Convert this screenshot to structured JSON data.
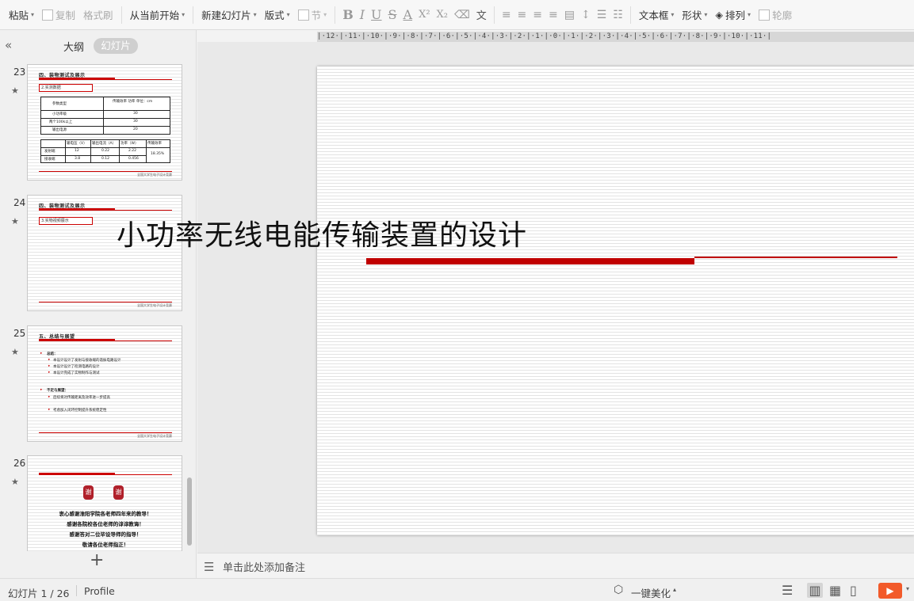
{
  "toolbar": {
    "paste": "粘贴",
    "copy": "复制",
    "format_painter": "格式刷",
    "from_current": "从当前开始",
    "new_slide": "新建幻灯片",
    "layout": "版式",
    "section": "节",
    "text_box": "文本框",
    "shape": "形状",
    "arrange": "排列",
    "outline": "轮廓"
  },
  "left_panel": {
    "tab_outline": "大纲",
    "tab_slides": "幻灯片",
    "thumbnails": [
      {
        "number": "23",
        "title": "四、装物测试及展示",
        "box_label": "2.实测数据",
        "table1": [
          [
            "参数类型",
            "传输效率 功率 单位：cm"
          ],
          [
            "小功率级",
            "30"
          ],
          [
            "两个100k以上",
            "30"
          ],
          [
            "输出电源",
            "20"
          ]
        ],
        "table2": [
          [
            "输电压（V）",
            "输出电流（A）",
            "功率（W）",
            "传输效率"
          ],
          [
            "发射端",
            "12",
            "0.22",
            "2.22",
            "18.35%"
          ],
          [
            "接收端",
            "3.8",
            "0.12",
            "0.456"
          ]
        ],
        "footer": "全国大学生电子设计竞赛"
      },
      {
        "number": "24",
        "title": "四、装物测试及展示",
        "box_label": "3.实物视频展示",
        "footer": "全国大学生电子设计竞赛"
      },
      {
        "number": "25",
        "title": "五、总结与展望",
        "summary_heading": "总结：",
        "summary_items": [
          "本设计设计了发射与接收端的谐振电路设计",
          "本设计设计了检测电路的设计",
          "本设计完成了实物制作与测试"
        ],
        "outlook_heading": "不足与展望：",
        "outlook_items": [
          "后续将对传输距离及效率进一步提高",
          "考虑加入闭环控制提升系统稳定性"
        ],
        "footer": "全国大学生电子设计竞赛"
      },
      {
        "number": "26",
        "seal_char": "谢",
        "lines": [
          "衷心感谢淮阳学院各老师四年来的教导！",
          "感谢各院校各位老师的谆谆教诲！",
          "感谢答对二位毕设导师的指导！",
          "敬请各位老师指正！"
        ]
      }
    ],
    "add_slide_glyph": "+"
  },
  "ruler": {
    "labels": "|·12·|·11·|·10·|·9·|·8·|·7·|·6·|·5·|·4·|·3·|·2·|·1·|·0·|·1·|·2·|·3·|·4·|·5·|·6·|·7·|·8·|·9·|·10·|·11·|"
  },
  "slide": {
    "title": "小功率无线电能传输装置的设计",
    "accent_color": "#c00000"
  },
  "notes": {
    "placeholder": "单击此处添加备注"
  },
  "status": {
    "slide_counter": "幻灯片 1 / 26",
    "profile": "Profile",
    "beautify": "一键美化"
  }
}
